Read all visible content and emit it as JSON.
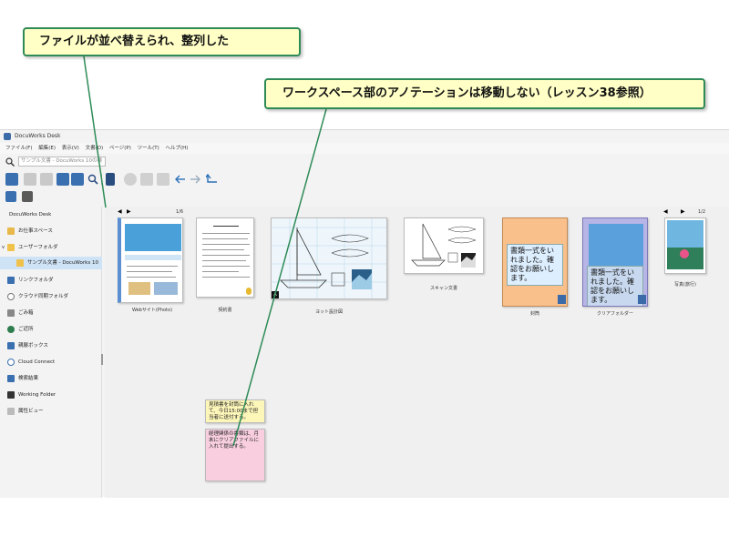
{
  "callouts": {
    "sorted": "ファイルが並べ替えられ、整列した",
    "annotations": "ワークスペース部のアノテーションは移動しない（レッスン38参照）"
  },
  "colors": {
    "callout_bg": "#ffffc6",
    "callout_border": "#2e8b57",
    "leader_line": "#2e8b57",
    "selected_bg": "#cfe3f7"
  },
  "app": {
    "title": "DocuWorks Desk",
    "menu": [
      "ファイル(F)",
      "編集(E)",
      "表示(V)",
      "文書(D)",
      "ページ(P)",
      "ツール(T)",
      "ヘルプ(H)"
    ],
    "search_placeholder": "サンプル文書 - DocuWorks 10の検",
    "search_icon": "search-icon"
  },
  "left_pane": {
    "header": "DocuWorks Desk",
    "items": [
      {
        "label": "お仕事スペース",
        "icon": "workspace-icon"
      },
      {
        "label": "ユーザーフォルダ",
        "icon": "folder-icon"
      },
      {
        "label": "サンプル文書 - DocuWorks 10",
        "icon": "folder-icon"
      },
      {
        "label": "リンクフォルダ",
        "icon": "link-folder-icon"
      },
      {
        "label": "クラウド同期フォルダ",
        "icon": "cloud-icon"
      },
      {
        "label": "ごみ箱",
        "icon": "trash-icon"
      },
      {
        "label": "ご近所",
        "icon": "neighbor-icon"
      },
      {
        "label": "親展ボックス",
        "icon": "box-icon"
      },
      {
        "label": "Cloud Connect",
        "icon": "cloud-connect-icon"
      },
      {
        "label": "検索結果",
        "icon": "search-result-icon"
      },
      {
        "label": "Working Folder",
        "icon": "working-folder-icon"
      },
      {
        "label": "属性ビュー",
        "icon": "attribute-view-icon"
      }
    ]
  },
  "workspace": {
    "page_indicator_1": "1/6",
    "page_indicator_2": "1/2",
    "documents": [
      {
        "label": "Webサイト(Photo)"
      },
      {
        "label": "契約書"
      },
      {
        "label": "ヨット設計図"
      },
      {
        "label": "スキャン文書"
      },
      {
        "label": "封筒"
      },
      {
        "label": "クリアフォルダー"
      },
      {
        "label": "写真(旅行)"
      }
    ],
    "envelope_text": "書類一式をいれました。確認をお願いします。",
    "clearfolder_text": "書類一式をいれました。確認をお願いします。",
    "note_yellow": "見積書を封筒に入れて、今日15:00まで担当者に送付する。",
    "note_pink": "経理関係の書類は、月末にクリアファイルに入れて提出する。"
  }
}
